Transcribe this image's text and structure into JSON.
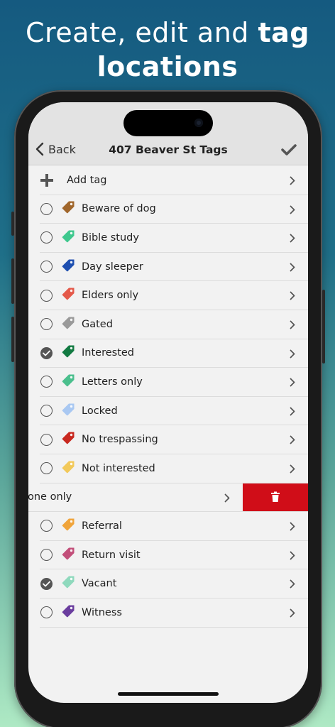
{
  "promo": {
    "line1_pre": "Create, edit and ",
    "line1_bold": "tag",
    "line2_bold": "locations"
  },
  "nav": {
    "back_label": "Back",
    "title": "407 Beaver St Tags"
  },
  "add_tag_label": "Add tag",
  "tags": [
    {
      "label": "Beware of dog",
      "color": "#a0662b",
      "checked": false
    },
    {
      "label": "Bible study",
      "color": "#3fc88e",
      "checked": false
    },
    {
      "label": "Day sleeper",
      "color": "#1e4fb0",
      "checked": false
    },
    {
      "label": "Elders only",
      "color": "#e4594a",
      "checked": false
    },
    {
      "label": "Gated",
      "color": "#9a9a9a",
      "checked": false
    },
    {
      "label": "Interested",
      "color": "#137a42",
      "checked": true
    },
    {
      "label": "Letters only",
      "color": "#4bbf8d",
      "checked": false
    },
    {
      "label": "Locked",
      "color": "#a9c8f2",
      "checked": false
    },
    {
      "label": "No trespassing",
      "color": "#c8281f",
      "checked": false
    },
    {
      "label": "Not interested",
      "color": "#f2c95a",
      "checked": false
    }
  ],
  "swiped_row_label": "one only",
  "tags_after": [
    {
      "label": "Referral",
      "color": "#f0a43a",
      "checked": false
    },
    {
      "label": "Return visit",
      "color": "#c24f7a",
      "checked": false
    },
    {
      "label": "Vacant",
      "color": "#8fd9bd",
      "checked": true
    },
    {
      "label": "Witness",
      "color": "#6a3d9e",
      "checked": false
    }
  ],
  "colors": {
    "delete": "#d00d18",
    "navbar": "#e3e3e3"
  }
}
